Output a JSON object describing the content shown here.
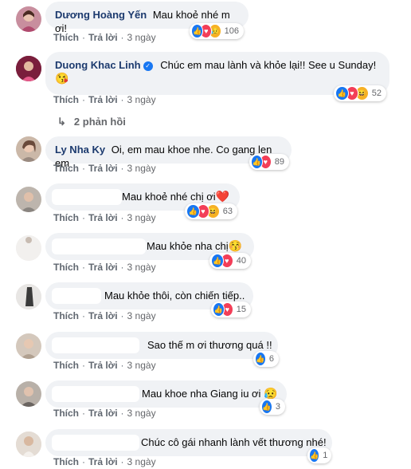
{
  "labels": {
    "like": "Thích",
    "reply": "Trả lời",
    "sep": "·"
  },
  "reaction_colors": {
    "like": "#1877f2",
    "love": "#f33e58",
    "haha": "#f7b125",
    "sad": "#f7b125"
  },
  "comments": [
    {
      "author": "Dương Hoàng Yến",
      "text": "Mau khoẻ nhé m ơi!",
      "time": "3 ngày",
      "reactions": [
        "like",
        "love",
        "sad"
      ],
      "count": "106"
    },
    {
      "author": "Duong Khac Linh",
      "verified": true,
      "text": "Chúc em mau lành và khỏe lại!! See u Sunday!",
      "emoji": "😘",
      "time": "3 ngày",
      "reactions": [
        "like",
        "love",
        "haha"
      ],
      "count": "52",
      "replies": "2 phản hồi"
    },
    {
      "author": "Ly Nha Ky",
      "text": "Oi, em mau khoe nhe. Co gang len em",
      "time": "3 ngày",
      "reactions": [
        "like",
        "love"
      ],
      "count": "89"
    },
    {
      "author": "",
      "text": "Mau khoẻ nhé chị ơi",
      "emoji": "❤️",
      "time": "3 ngày",
      "reactions": [
        "like",
        "love",
        "haha"
      ],
      "count": "63"
    },
    {
      "author": "",
      "text": "Mau khỏe nha chị",
      "emoji": "😚",
      "time": "3 ngày",
      "reactions": [
        "like",
        "love"
      ],
      "count": "40"
    },
    {
      "author": "",
      "text": "Mau khỏe thôi, còn chiến tiếp..",
      "time": "3 ngày",
      "reactions": [
        "like",
        "love"
      ],
      "count": "15"
    },
    {
      "author": "",
      "text": "Sao thế m ơi thương quá !!",
      "time": "3 ngày",
      "reactions": [
        "like"
      ],
      "count": "6"
    },
    {
      "author": "",
      "text": "Mau khoe nha Giang iu ơi",
      "emoji": "😥",
      "time": "3 ngày",
      "reactions": [
        "like"
      ],
      "count": "3"
    },
    {
      "author": "",
      "text": "Chúc cô gái nhanh lành vết thương nhé!",
      "time": "3 ngày",
      "reactions": [
        "like"
      ],
      "count": "1"
    }
  ]
}
